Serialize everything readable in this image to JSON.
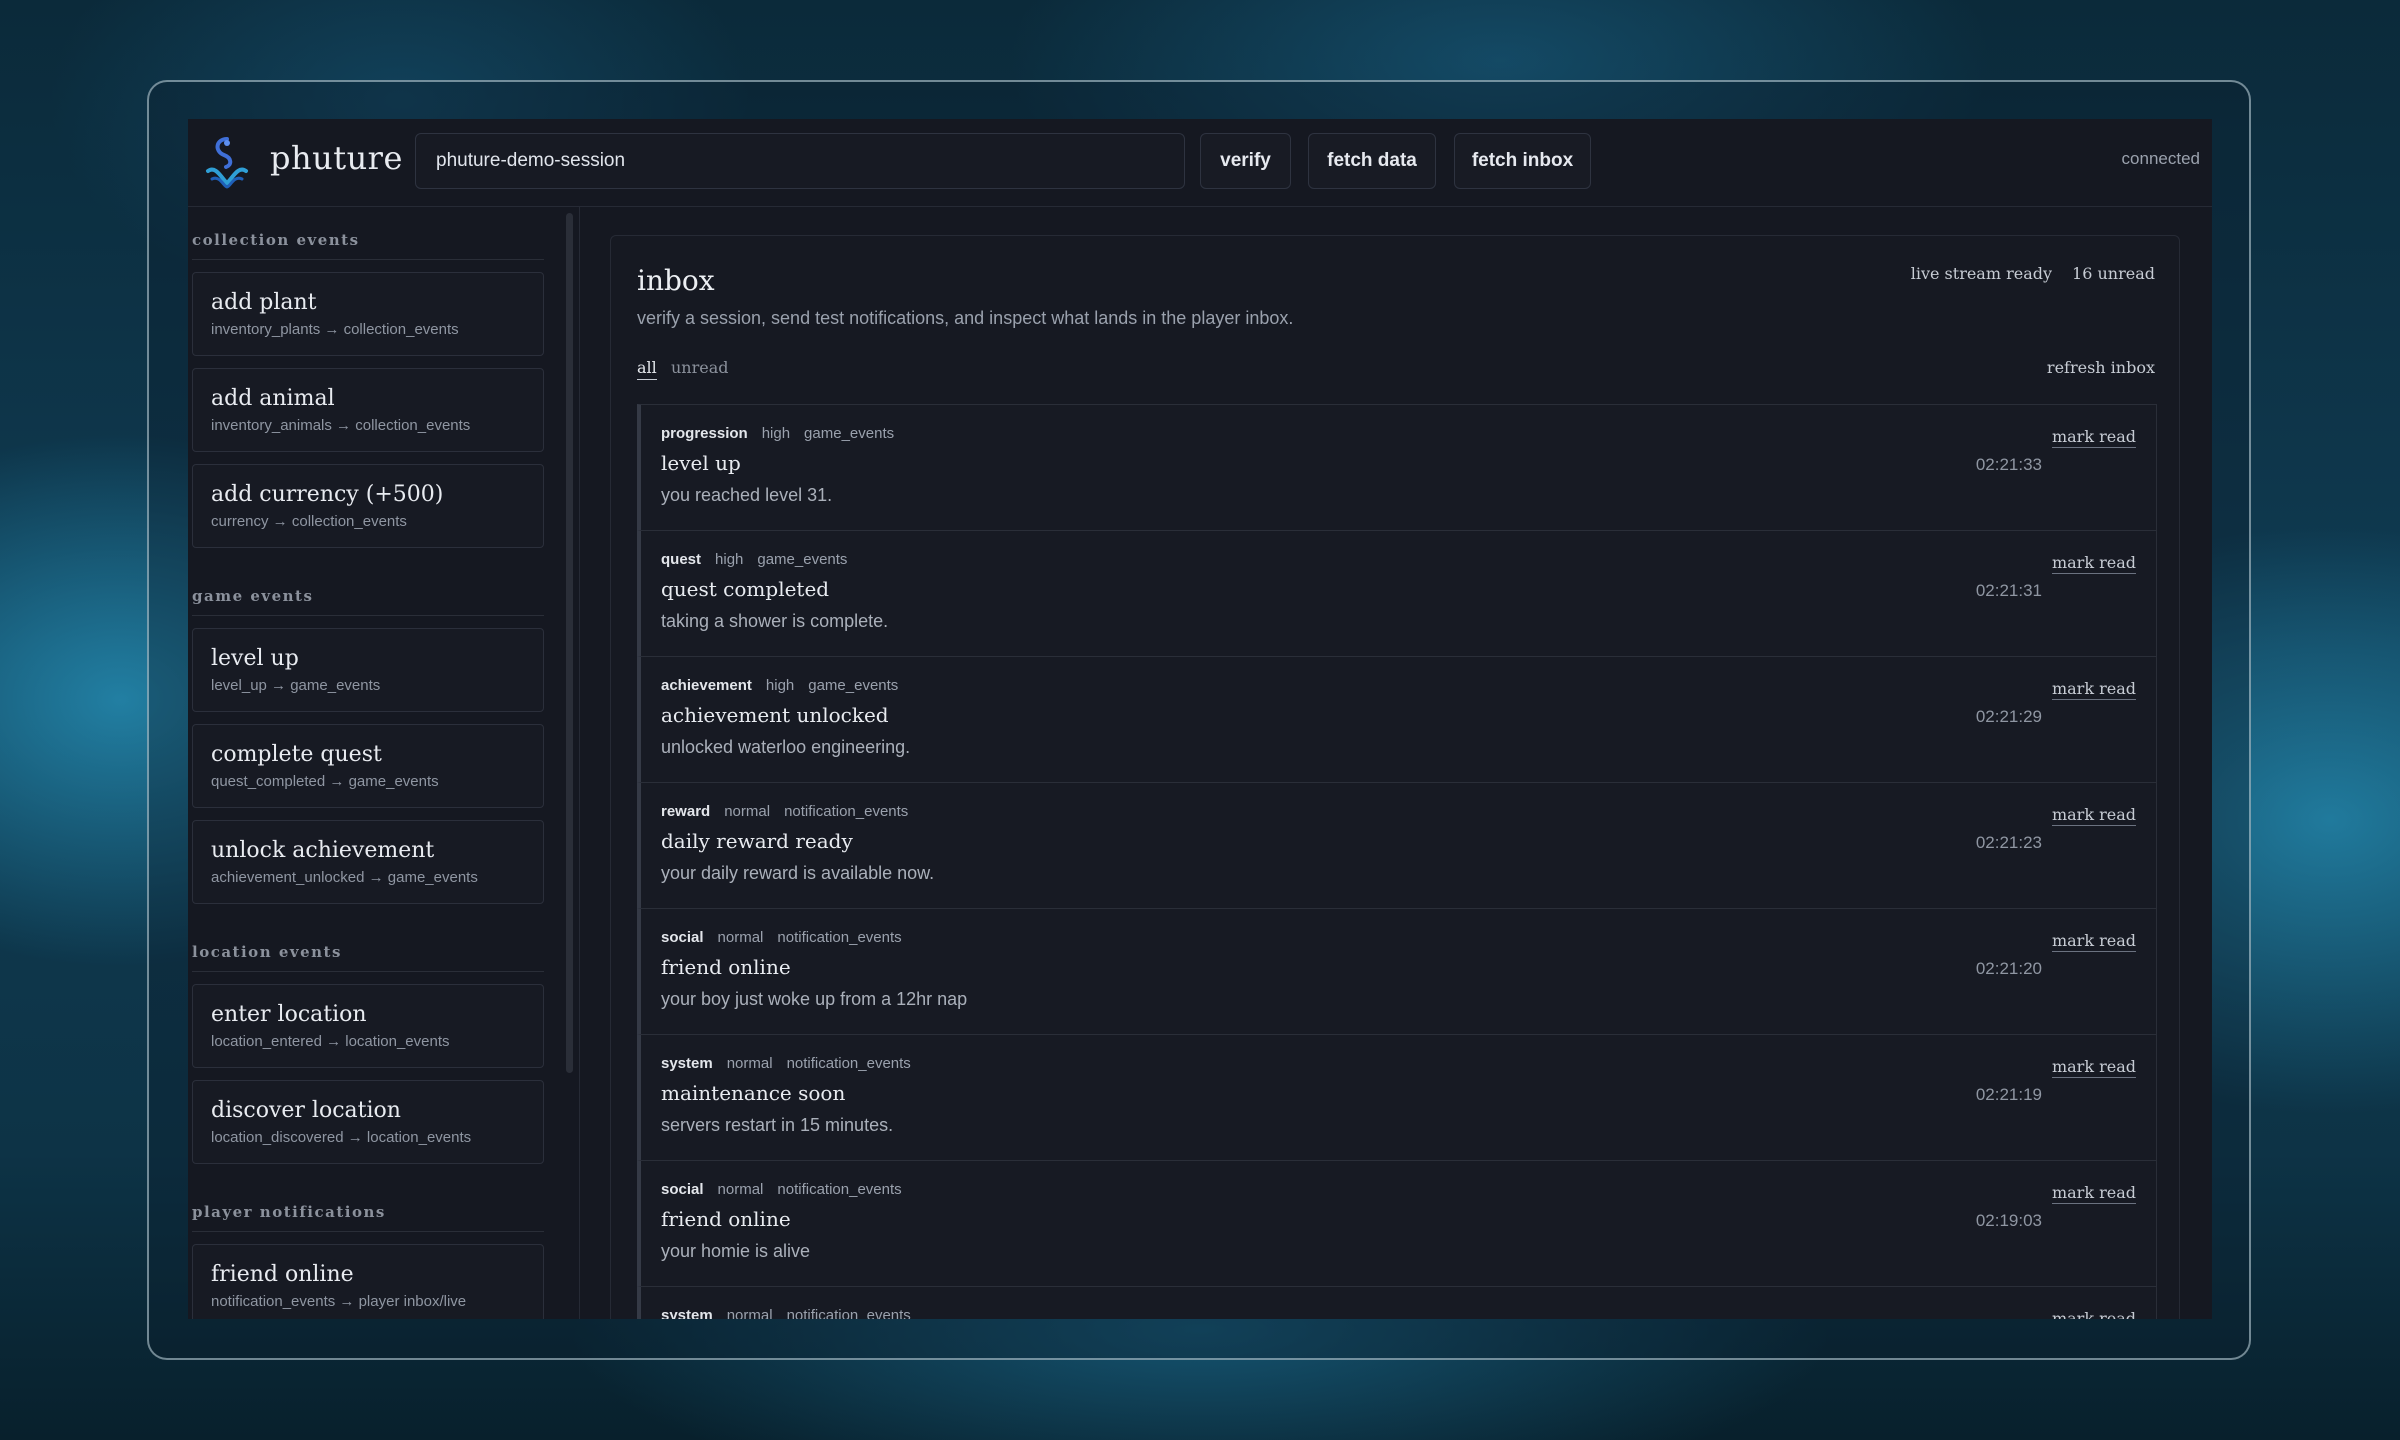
{
  "header": {
    "brand": "phuture",
    "session_value": "phuture-demo-session",
    "verify_label": "verify",
    "fetch_data_label": "fetch data",
    "fetch_inbox_label": "fetch inbox",
    "status": "connected",
    "logo_icon": "phuture-logo-icon"
  },
  "sidebar": {
    "sections": [
      {
        "title": "collection events",
        "items": [
          {
            "title": "add plant",
            "sub": "inventory_plants → collection_events"
          },
          {
            "title": "add animal",
            "sub": "inventory_animals → collection_events"
          },
          {
            "title": "add currency (+500)",
            "sub": "currency → collection_events"
          }
        ]
      },
      {
        "title": "game events",
        "items": [
          {
            "title": "level up",
            "sub": "level_up → game_events"
          },
          {
            "title": "complete quest",
            "sub": "quest_completed → game_events"
          },
          {
            "title": "unlock achievement",
            "sub": "achievement_unlocked → game_events"
          }
        ]
      },
      {
        "title": "location events",
        "items": [
          {
            "title": "enter location",
            "sub": "location_entered → location_events"
          },
          {
            "title": "discover location",
            "sub": "location_discovered → location_events"
          }
        ]
      },
      {
        "title": "player notifications",
        "items": [
          {
            "title": "friend online",
            "sub": "notification_events → player inbox/live"
          }
        ]
      }
    ]
  },
  "inbox": {
    "title": "inbox",
    "description": "verify a session, send test notifications, and inspect what lands in the player inbox.",
    "live_status": "live stream ready",
    "unread_count": "16 unread",
    "filter_all": "all",
    "filter_unread": "unread",
    "refresh_label": "refresh inbox",
    "mark_read_label": "mark read",
    "messages": [
      {
        "category": "progression",
        "priority": "high",
        "source": "game_events",
        "title": "level up",
        "body": "you reached level 31.",
        "time": "02:21:33"
      },
      {
        "category": "quest",
        "priority": "high",
        "source": "game_events",
        "title": "quest completed",
        "body": "taking a shower is complete.",
        "time": "02:21:31"
      },
      {
        "category": "achievement",
        "priority": "high",
        "source": "game_events",
        "title": "achievement unlocked",
        "body": "unlocked waterloo engineering.",
        "time": "02:21:29"
      },
      {
        "category": "reward",
        "priority": "normal",
        "source": "notification_events",
        "title": "daily reward ready",
        "body": "your daily reward is available now.",
        "time": "02:21:23"
      },
      {
        "category": "social",
        "priority": "normal",
        "source": "notification_events",
        "title": "friend online",
        "body": "your boy just woke up from a 12hr nap",
        "time": "02:21:20"
      },
      {
        "category": "system",
        "priority": "normal",
        "source": "notification_events",
        "title": "maintenance soon",
        "body": "servers restart in 15 minutes.",
        "time": "02:21:19"
      },
      {
        "category": "social",
        "priority": "normal",
        "source": "notification_events",
        "title": "friend online",
        "body": "your homie is alive",
        "time": "02:19:03"
      },
      {
        "category": "system",
        "priority": "normal",
        "source": "notification_events",
        "title": "",
        "body": "",
        "time": ""
      }
    ]
  }
}
